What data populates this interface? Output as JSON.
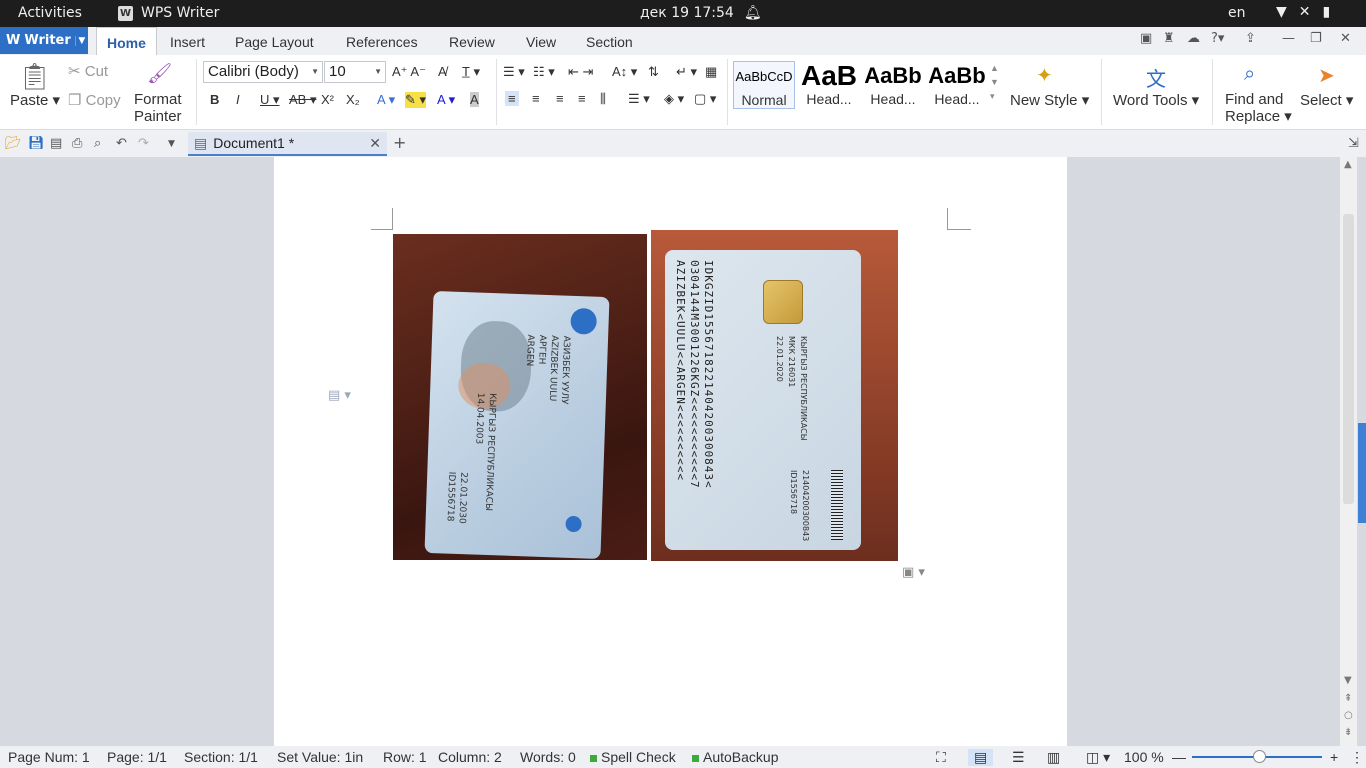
{
  "system": {
    "activities": "Activities",
    "app_name": "WPS Writer",
    "clock": "дек 19  17:54",
    "lang": "en"
  },
  "tabs": {
    "writer": "Writer",
    "items": [
      "Home",
      "Insert",
      "Page Layout",
      "References",
      "Review",
      "View",
      "Section"
    ]
  },
  "ribbon": {
    "paste": "Paste",
    "cut": "Cut",
    "copy": "Copy",
    "format_painter_1": "Format",
    "format_painter_2": "Painter",
    "font_name": "Calibri (Body)",
    "font_size": "10",
    "styles": [
      {
        "preview": "AaBbCcD",
        "name": "Normal"
      },
      {
        "preview": "AaB",
        "name": "Head..."
      },
      {
        "preview": "AaBb",
        "name": "Head..."
      },
      {
        "preview": "AaBb",
        "name": "Head..."
      }
    ],
    "new_style": "New Style",
    "word_tools": "Word Tools",
    "find_replace_1": "Find and",
    "find_replace_2": "Replace",
    "select": "Select"
  },
  "document": {
    "tab_title": "Document1 *"
  },
  "images": {
    "card_front_name": "АЗИЗБЕК УУЛУ",
    "card_front_name2": "AZIZBEK UULU",
    "card_front_given": "АРГЕН",
    "card_front_given2": "ARGEN",
    "card_front_country": "КЫРГЫЗ РЕСПУБЛИКАСЫ",
    "card_front_dob": "14.04.2003",
    "card_front_exp": "22.01.2030",
    "card_front_id": "ID1556718",
    "card_back_country": "КЫРГЫЗ РЕСПУБЛИКАСЫ",
    "card_back_authority": "МКК 216031",
    "card_back_date": "22.01.2020",
    "card_back_pin": "21404200300843",
    "card_back_id": "ID1556718",
    "mrz1": "IDKGZID1556718221404200300843<",
    "mrz2": "0304144M3001226KGZ<<<<<<<<<<<7",
    "mrz3": "AZIZBEK<UULU<<ARGEN<<<<<<<<<<"
  },
  "status": {
    "page_num": "Page Num: 1",
    "page": "Page: 1/1",
    "section": "Section: 1/1",
    "set_value": "Set Value: 1in",
    "row": "Row: 1",
    "column": "Column: 2",
    "words": "Words: 0",
    "spell_check": "Spell Check",
    "autobackup": "AutoBackup",
    "zoom": "100 %",
    "zoom_fraction": 0.5
  },
  "colors": {
    "accent": "#2d6fc5",
    "topbar": "#1d1d1d",
    "wood": "#5a2a1c"
  }
}
